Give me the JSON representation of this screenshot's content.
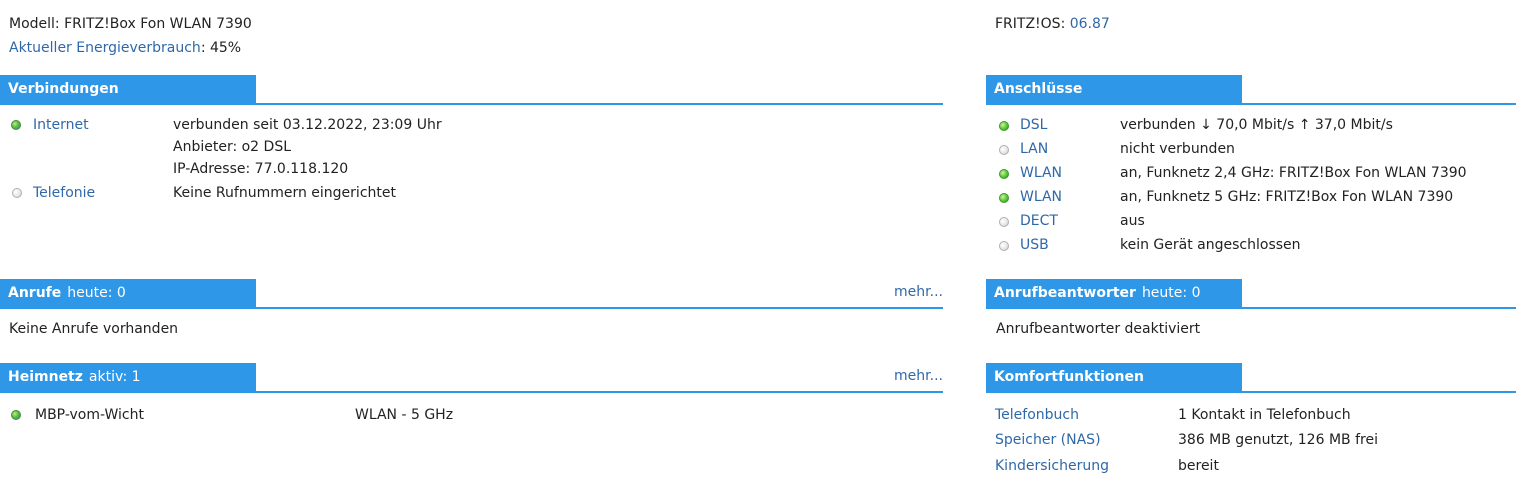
{
  "header": {
    "model_label": "Modell:",
    "model_value": "FRITZ!Box Fon WLAN 7390",
    "energy_label": "Aktueller Energieverbrauch",
    "energy_value": ": 45%",
    "os_label": "FRITZ!OS:",
    "os_version": "06.87"
  },
  "verbindungen": {
    "title": "Verbindungen",
    "rows": [
      {
        "label": "Internet",
        "status": "globe",
        "lines": [
          "verbunden seit 03.12.2022, 23:09 Uhr",
          "Anbieter: o2 DSL",
          "IP-Adresse: 77.0.118.120"
        ]
      },
      {
        "label": "Telefonie",
        "status": "grey",
        "lines": [
          "Keine Rufnummern eingerichtet"
        ]
      }
    ]
  },
  "anschluesse": {
    "title": "Anschlüsse",
    "rows": [
      {
        "label": "DSL",
        "status": "green",
        "value": "verbunden ↓ 70,0 Mbit/s ↑ 37,0 Mbit/s"
      },
      {
        "label": "LAN",
        "status": "grey",
        "value": "nicht verbunden"
      },
      {
        "label": "WLAN",
        "status": "green",
        "value": "an, Funknetz 2,4 GHz: FRITZ!Box Fon WLAN 7390"
      },
      {
        "label": "WLAN",
        "status": "green",
        "value": "an, Funknetz 5 GHz: FRITZ!Box Fon WLAN 7390"
      },
      {
        "label": "DECT",
        "status": "grey",
        "value": "aus"
      },
      {
        "label": "USB",
        "status": "grey",
        "value": "kein Gerät angeschlossen"
      }
    ]
  },
  "anrufe": {
    "title": "Anrufe",
    "subtitle": "heute: 0",
    "more": "mehr...",
    "body": "Keine Anrufe vorhanden"
  },
  "anrufbeantworter": {
    "title": "Anrufbeantworter",
    "subtitle": "heute: 0",
    "body": "Anrufbeantworter deaktiviert"
  },
  "heimnetz": {
    "title": "Heimnetz",
    "subtitle": "aktiv: 1",
    "more": "mehr...",
    "devices": [
      {
        "name": "MBP-vom-Wicht",
        "status": "globe",
        "connection": "WLAN - 5 GHz"
      }
    ]
  },
  "komfort": {
    "title": "Komfortfunktionen",
    "rows": [
      {
        "label": "Telefonbuch",
        "value": "1 Kontakt in Telefonbuch"
      },
      {
        "label": "Speicher (NAS)",
        "value": "386 MB genutzt, 126 MB frei"
      },
      {
        "label": "Kindersicherung",
        "value": "bereit"
      }
    ]
  }
}
